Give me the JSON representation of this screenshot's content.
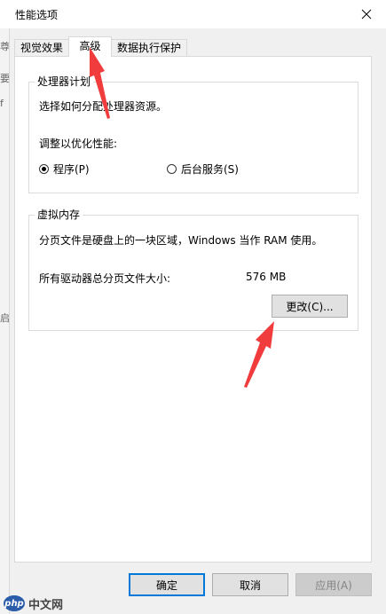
{
  "window": {
    "title": "性能选项"
  },
  "background_window": {
    "edge_chars": [
      "统",
      "尊",
      "要",
      "f",
      "启"
    ]
  },
  "tabs": [
    {
      "label": "视觉效果",
      "active": false
    },
    {
      "label": "高级",
      "active": true
    },
    {
      "label": "数据执行保护",
      "active": false
    }
  ],
  "processor_scheduling": {
    "group_label": "处理器计划",
    "description": "选择如何分配处理器资源。",
    "adjust_label": "调整以优化性能:",
    "options": [
      {
        "label": "程序(P)",
        "checked": true
      },
      {
        "label": "后台服务(S)",
        "checked": false
      }
    ]
  },
  "virtual_memory": {
    "group_label": "虚拟内存",
    "description": "分页文件是硬盘上的一块区域，Windows 当作 RAM 使用。",
    "total_label": "所有驱动器总分页文件大小:",
    "total_value": "576 MB",
    "change_button": "更改(C)..."
  },
  "footer": {
    "ok_button": "确定",
    "cancel_button": "取消",
    "apply_button": "应用(A)"
  },
  "watermark": {
    "logo_text": "php",
    "site_text": "中文网"
  },
  "colors": {
    "annotation_arrow": "#f03c3c",
    "default_button_border": "#0078d7"
  }
}
